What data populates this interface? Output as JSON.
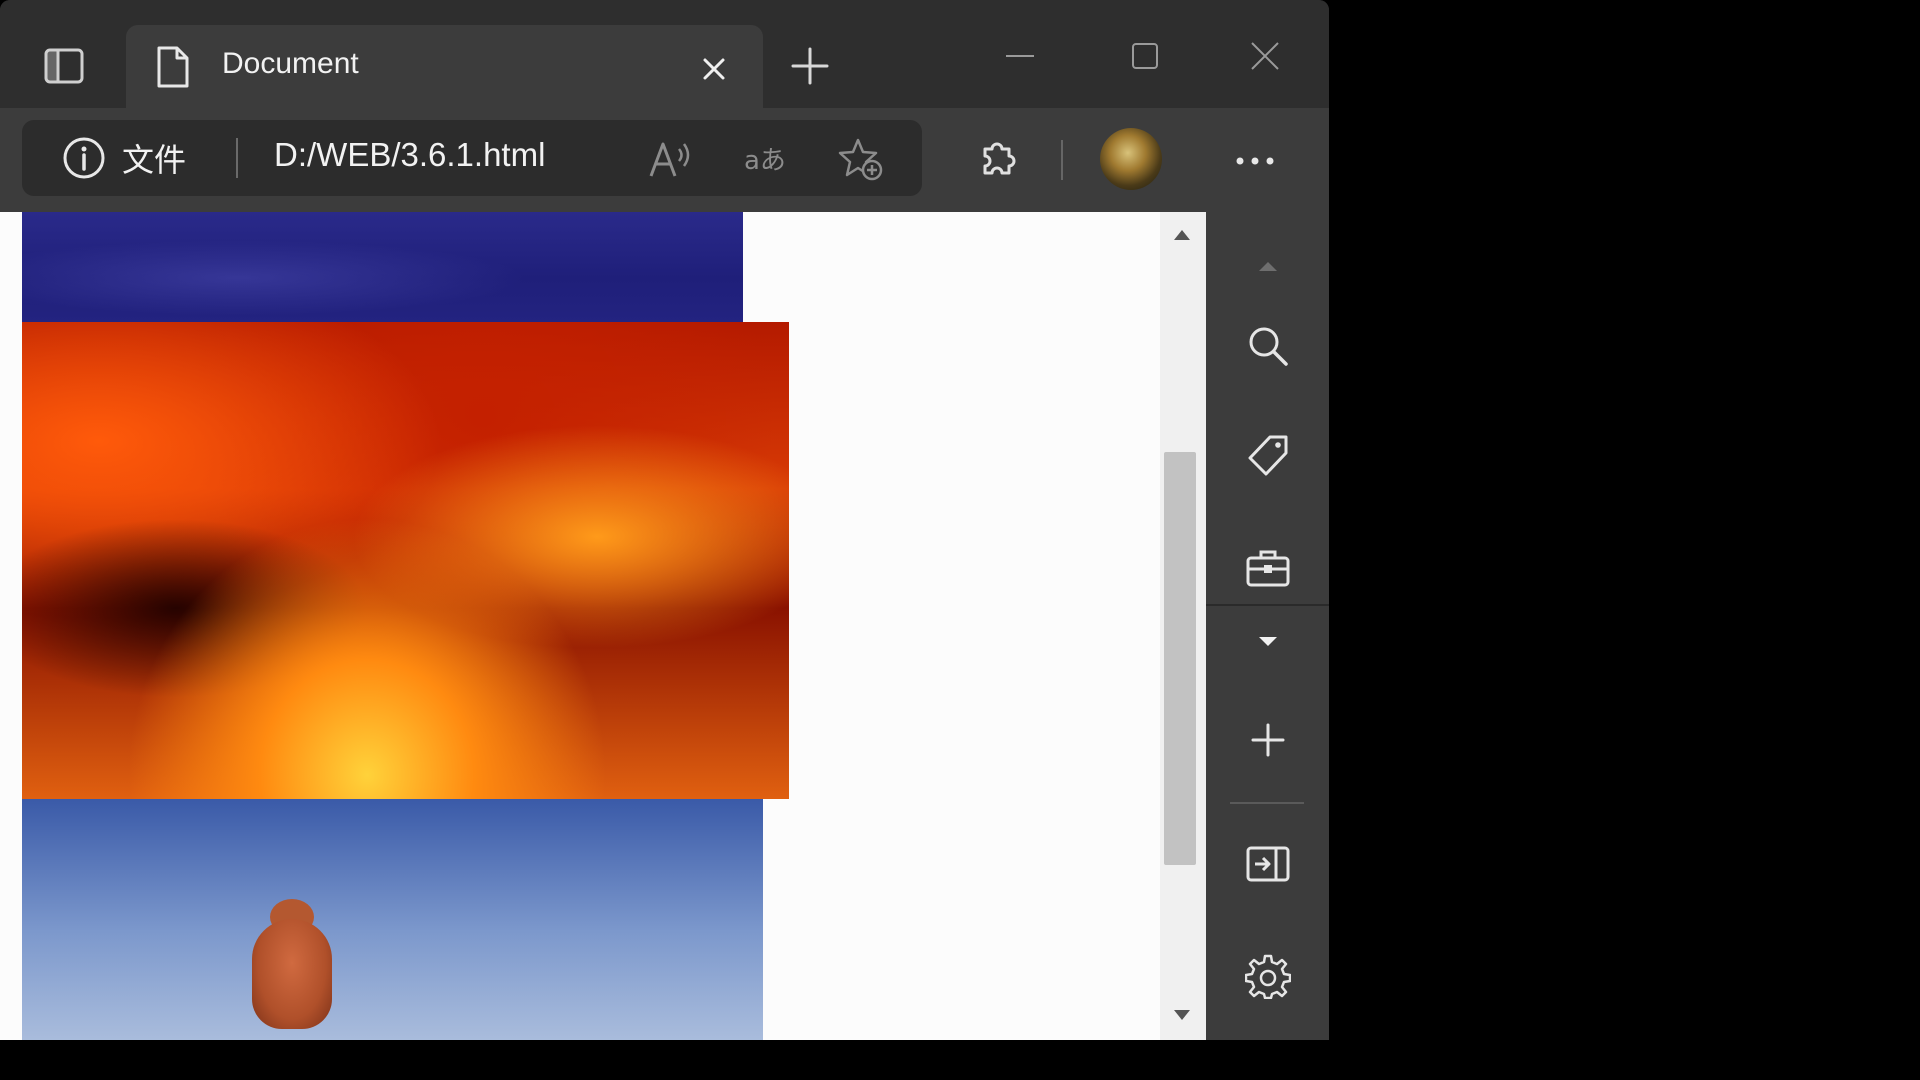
{
  "tab": {
    "title": "Document",
    "icon": "document-icon"
  },
  "addressbar": {
    "site_label": "文件",
    "url": "D:/WEB/3.6.1.html"
  },
  "icons": {
    "tab_actions": "tab-actions-icon",
    "new_tab": "plus-icon",
    "read_aloud": "read-aloud-icon",
    "translate": "translate-icon",
    "favorites": "add-favorite-icon",
    "extensions": "puzzle-icon",
    "more": "more-icon"
  },
  "sidebar": {
    "items": [
      "search-icon",
      "shopping-tag-icon",
      "tools-icon",
      "add-icon",
      "hide-sidebar-icon",
      "settings-icon"
    ]
  },
  "colors": {
    "frame": "#2e2e2e",
    "toolbar": "#3c3c3c",
    "addressbar": "#2c2c2c",
    "page": "#fcfcfc"
  }
}
